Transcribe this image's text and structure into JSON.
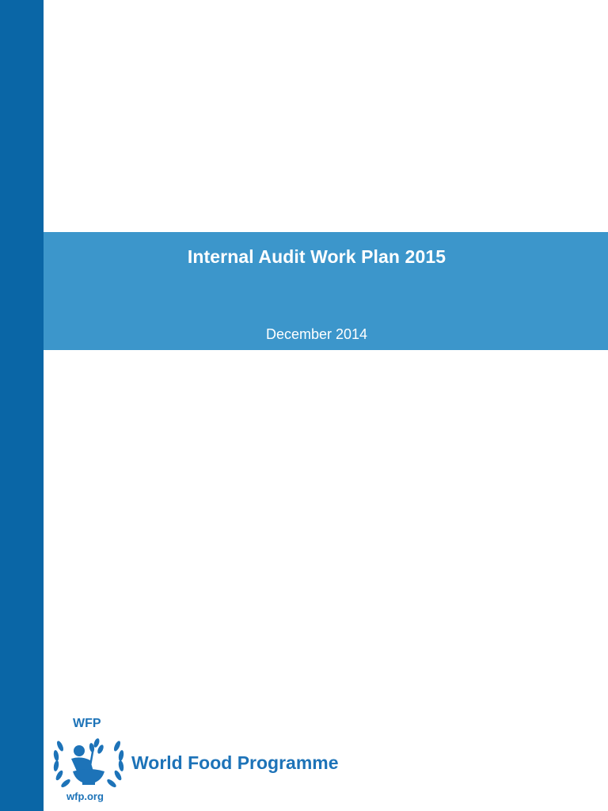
{
  "document": {
    "title": "Internal Audit Work Plan 2015",
    "date": "December 2014"
  },
  "logo": {
    "acronym": "WFP",
    "organization": "World Food Programme",
    "url": "wfp.org",
    "emblem_icon": "un-wreath-emblem-icon"
  },
  "colors": {
    "side_bar": "#0a66a6",
    "title_band": "#3c96cb",
    "logo_blue": "#1d73b8"
  }
}
